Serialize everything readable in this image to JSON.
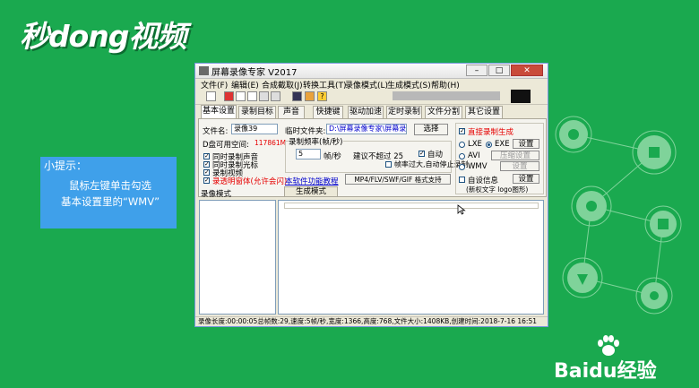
{
  "branding": {
    "top_logo": "秒dong视频",
    "bottom_logo": "Baidu经验"
  },
  "tip": {
    "title": "小提示：",
    "line1": "鼠标左键单击勾选",
    "line2": "基本设置里的“WMV”"
  },
  "window": {
    "title": "屏幕录像专家 V2017",
    "menu": [
      "文件(F)",
      "编辑(E)",
      "合成截取(J)",
      "转换工具(T)",
      "录像模式(L)",
      "生成模式(S)",
      "帮助(H)"
    ],
    "tabs": [
      "基本设置",
      "录制目标",
      "声音",
      "快捷键",
      "驱动加速",
      "定时录制",
      "文件分割",
      "其它设置"
    ],
    "active_tab": "基本设置",
    "basic": {
      "filename_label": "文件名:",
      "filename_value": "录像39",
      "temp_folder_label": "临时文件夹:",
      "temp_folder_value": "D:\\屏幕录像专家\\屏幕录",
      "choose_button": "选择",
      "disk_space_label": "D盘可用空间:",
      "disk_space_value": "117861M",
      "options": [
        {
          "label": "同时录制声音",
          "checked": true
        },
        {
          "label": "同时录制光标",
          "checked": true
        },
        {
          "label": "录制视频",
          "checked": true
        },
        {
          "label": "录透明窗体(允许会闪)",
          "checked": true
        }
      ],
      "tutorial_link": "本软件功能教程",
      "fps_group_title": "录制频率(帧/秒)",
      "fps_value": "5",
      "fps_unit": "帧/秒",
      "suggest_text": "建议不超过 25",
      "auto_label": "自动",
      "auto_checked": true,
      "overflow_label": "帧率过大,自动停止录制",
      "overflow_checked": false,
      "format_button": "MP4/FLV/SWF/GIF 格式支持",
      "direct_gen_label": "直接录制生成",
      "direct_gen_checked": true,
      "formats": [
        {
          "label": "LXE",
          "selected": false
        },
        {
          "label": "EXE",
          "selected": true
        },
        {
          "label": "AVI",
          "selected": false
        },
        {
          "label": "WMV",
          "selected": false
        }
      ],
      "settings_button": "设置",
      "compress_button": "压缩设置",
      "settings2_button": "设置",
      "auto_info_label": "自设信息",
      "auto_info_checked": false,
      "settings3_button": "设置",
      "logo_text": "(新权文字 logo图形)"
    },
    "record_mode_label": "录像模式",
    "gen_mode_label": "生成模式",
    "status": "录像长度:00:00:05总帧数:29,速度:5帧/秒,宽度:1366,高度:768,文件大小:1408KB,创建时间:2018-7-16 16:51"
  },
  "colors": {
    "background": "#1aa94f",
    "tip_box": "#3fa0ea",
    "window_bg": "#ece9d8"
  }
}
